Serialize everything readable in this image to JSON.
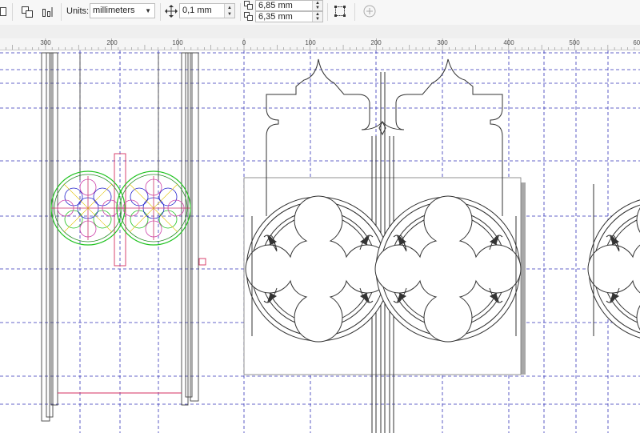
{
  "toolbar": {
    "units_label": "Units:",
    "units_value": "millimeters",
    "nudge_value": "0,1 mm",
    "duplicate_x": "6,85 mm",
    "duplicate_y": "6,35 mm"
  },
  "ruler": {
    "labels": [
      "300",
      "200",
      "100",
      "0",
      "100",
      "200",
      "300",
      "400",
      "500",
      "600"
    ]
  }
}
